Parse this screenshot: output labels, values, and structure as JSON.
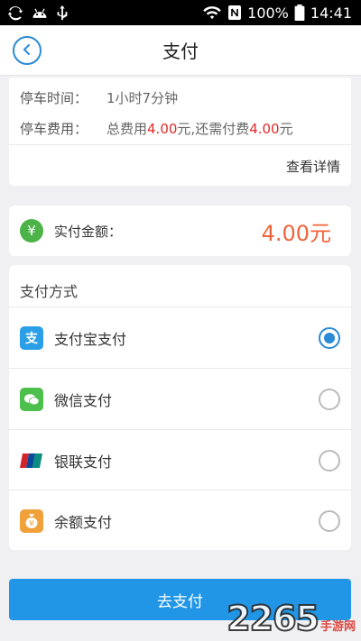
{
  "status_bar": {
    "battery": "100%",
    "time": "14:41"
  },
  "header": {
    "title": "支付"
  },
  "parking_info": {
    "time_label": "停车时间：",
    "time_value": "1小时7分钟",
    "fee_label": "停车费用：",
    "fee_total_prefix": "总费用",
    "fee_total_amount": "4.00",
    "fee_mid": "元,还需付费",
    "fee_due_amount": "4.00",
    "fee_suffix": "元",
    "details_link": "查看详情"
  },
  "amount": {
    "label": "实付金额：",
    "value": "4.00元"
  },
  "payment_methods": {
    "header": "支付方式",
    "options": [
      {
        "label": "支付宝支付",
        "icon": "alipay-icon",
        "selected": true
      },
      {
        "label": "微信支付",
        "icon": "wechat-icon",
        "selected": false
      },
      {
        "label": "银联支付",
        "icon": "unionpay-icon",
        "selected": false
      },
      {
        "label": "余额支付",
        "icon": "balance-icon",
        "selected": false
      }
    ]
  },
  "pay_button": "去支付",
  "watermark": {
    "number": "2265",
    "suffix": "手游网"
  }
}
